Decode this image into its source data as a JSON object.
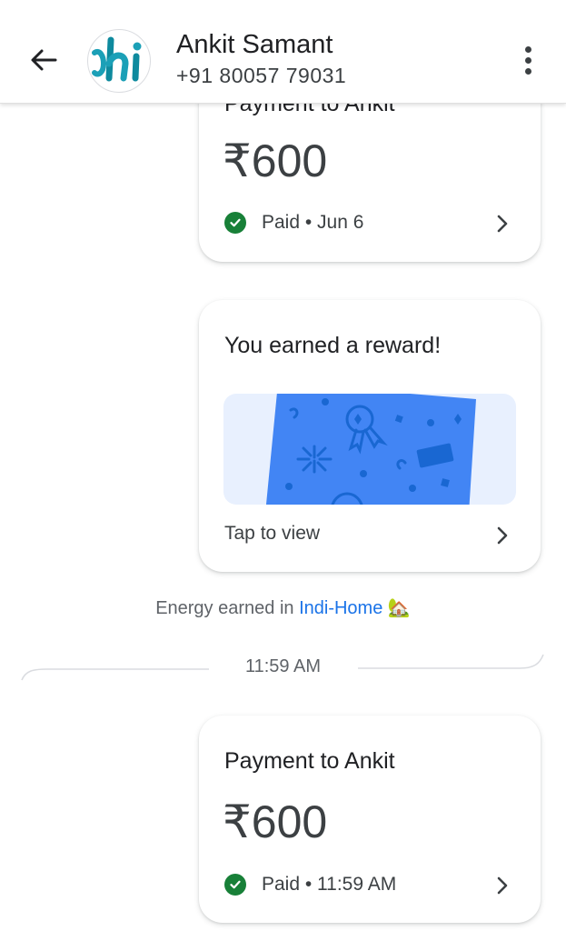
{
  "header": {
    "contact_name": "Ankit Samant",
    "contact_phone": "+91 80057 79031",
    "avatar_text": "hi"
  },
  "payment_card_top": {
    "title": "Payment to Ankit",
    "amount": "₹600",
    "status": "Paid • Jun 6"
  },
  "reward_card": {
    "title": "You earned a reward!",
    "action": "Tap to view"
  },
  "energy_note": {
    "prefix": "Energy earned in ",
    "link": "Indi-Home",
    "emoji": "🏡"
  },
  "divider": {
    "time": "11:59 AM"
  },
  "payment_card_bottom": {
    "title": "Payment to Ankit",
    "amount": "₹600",
    "status": "Paid • 11:59 AM"
  },
  "colors": {
    "paid_green": "#188038",
    "link_blue": "#1a73e8",
    "reward_blue": "#4285f4",
    "reward_bg": "#e8f0fe"
  }
}
